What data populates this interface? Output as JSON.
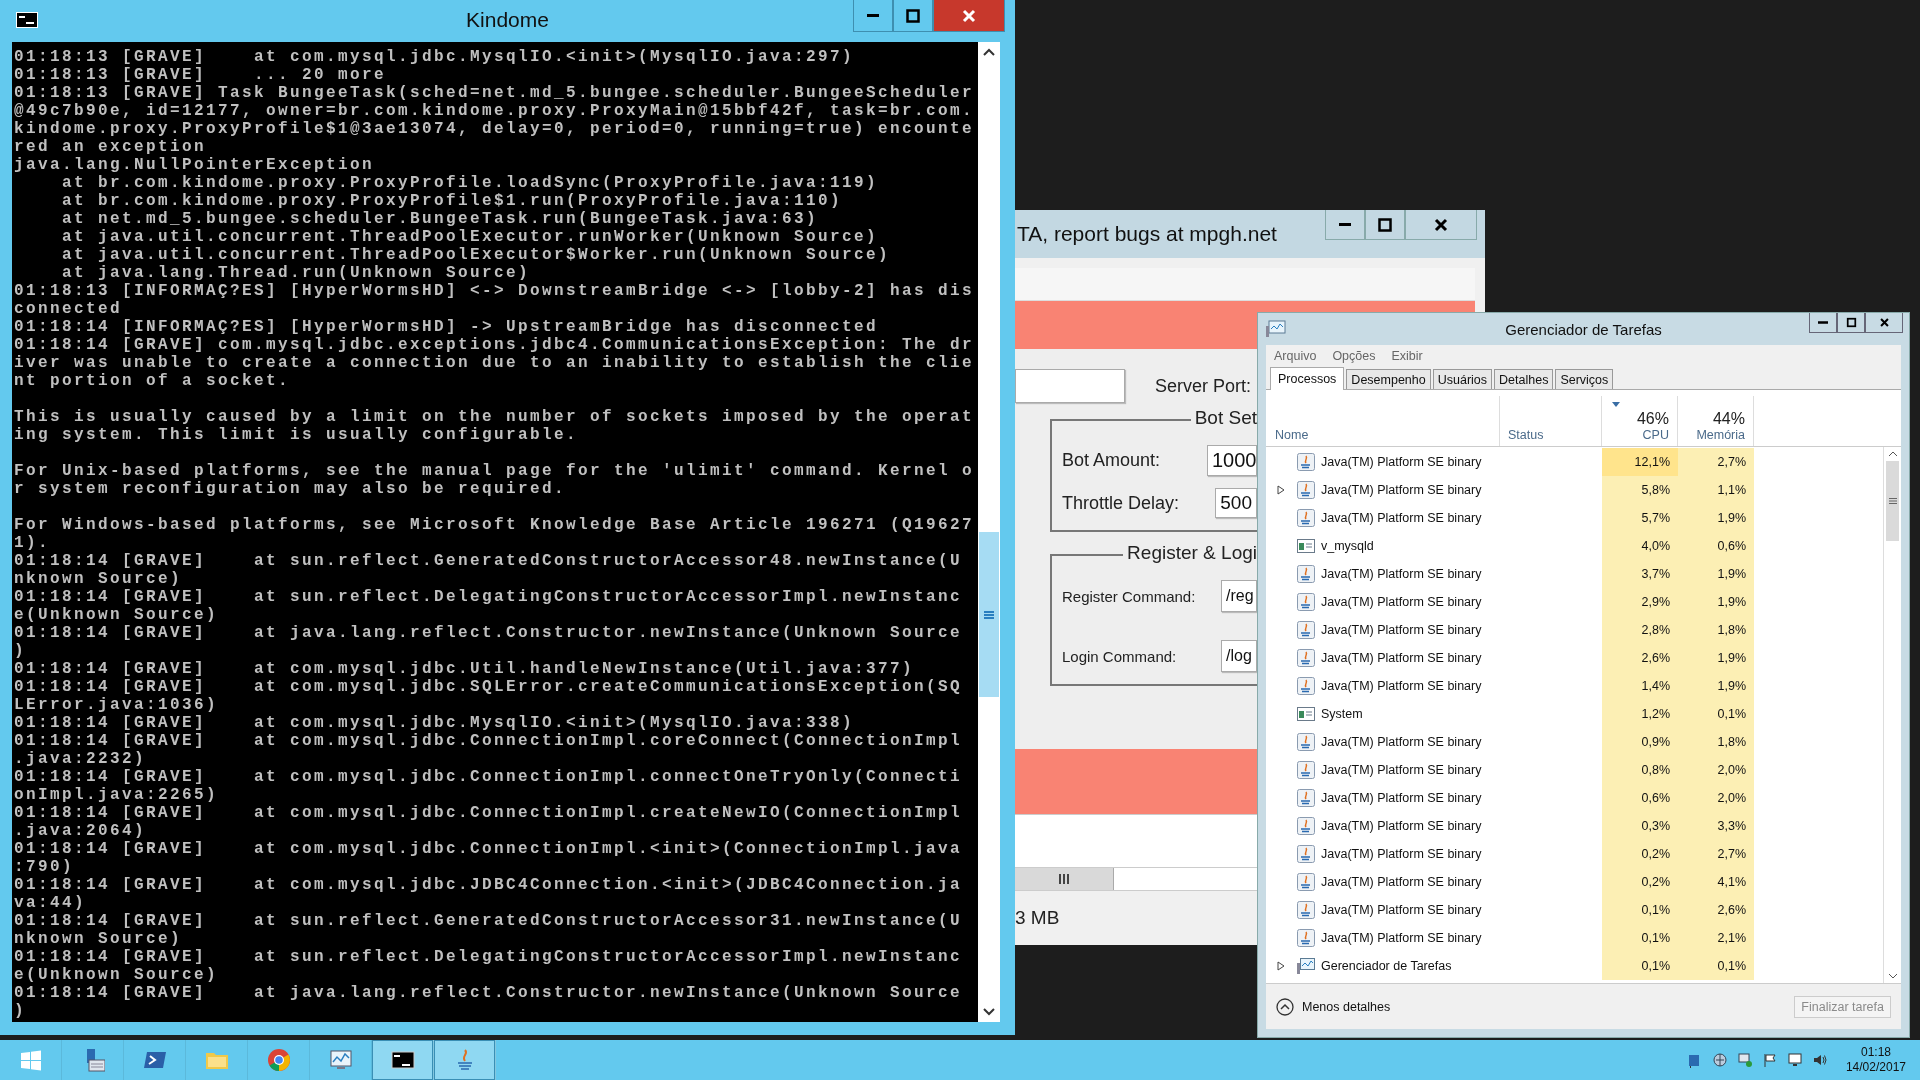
{
  "console_window": {
    "title": "Kindome",
    "blocks": [
      [
        "01:18:13 [GRAVE]    at com.mysql.jdbc.MysqlIO.<init>(MysqlIO.java:297)",
        "01:18:13 [GRAVE]    ... 20 more",
        "01:18:13 [GRAVE] Task BungeeTask(sched=net.md_5.bungee.scheduler.BungeeScheduler",
        "@49c7b90e, id=12177, owner=br.com.kindome.proxy.ProxyMain@15bbf42f, task=br.com.",
        "kindome.proxy.ProxyProfile$1@3ae13074, delay=0, period=0, running=true) encounte",
        "red an exception",
        "java.lang.NullPointerException",
        "    at br.com.kindome.proxy.ProxyProfile.loadSync(ProxyProfile.java:119)",
        "    at br.com.kindome.proxy.ProxyProfile$1.run(ProxyProfile.java:110)",
        "    at net.md_5.bungee.scheduler.BungeeTask.run(BungeeTask.java:63)",
        "    at java.util.concurrent.ThreadPoolExecutor.runWorker(Unknown Source)",
        "    at java.util.concurrent.ThreadPoolExecutor$Worker.run(Unknown Source)",
        "    at java.lang.Thread.run(Unknown Source)",
        "01:18:13 [INFORMAÇ?ES] [HyperWormsHD] <-> DownstreamBridge <-> [lobby-2] has dis",
        "connected",
        "01:18:14 [INFORMAÇ?ES] [HyperWormsHD] -> UpstreamBridge has disconnected",
        "01:18:14 [GRAVE] com.mysql.jdbc.exceptions.jdbc4.CommunicationsException: The dr",
        "iver was unable to create a connection due to an inability to establish the clie",
        "nt portion of a socket."
      ],
      [
        "This is usually caused by a limit on the number of sockets imposed by the operat",
        "ing system. This limit is usually configurable."
      ],
      [
        "For Unix-based platforms, see the manual page for the 'ulimit' command. Kernel o",
        "r system reconfiguration may also be required."
      ],
      [
        "For Windows-based platforms, see Microsoft Knowledge Base Article 196271 (Q19627",
        "1).",
        "01:18:14 [GRAVE]    at sun.reflect.GeneratedConstructorAccessor48.newInstance(U",
        "nknown Source)",
        "01:18:14 [GRAVE]    at sun.reflect.DelegatingConstructorAccessorImpl.newInstanc",
        "e(Unknown Source)",
        "01:18:14 [GRAVE]    at java.lang.reflect.Constructor.newInstance(Unknown Source",
        ")",
        "01:18:14 [GRAVE]    at com.mysql.jdbc.Util.handleNewInstance(Util.java:377)",
        "01:18:14 [GRAVE]    at com.mysql.jdbc.SQLError.createCommunicationsException(SQ",
        "LError.java:1036)",
        "01:18:14 [GRAVE]    at com.mysql.jdbc.MysqlIO.<init>(MysqlIO.java:338)",
        "01:18:14 [GRAVE]    at com.mysql.jdbc.ConnectionImpl.coreConnect(ConnectionImpl",
        ".java:2232)",
        "01:18:14 [GRAVE]    at com.mysql.jdbc.ConnectionImpl.connectOneTryOnly(Connecti",
        "onImpl.java:2265)",
        "01:18:14 [GRAVE]    at com.mysql.jdbc.ConnectionImpl.createNewIO(ConnectionImpl",
        ".java:2064)",
        "01:18:14 [GRAVE]    at com.mysql.jdbc.ConnectionImpl.<init>(ConnectionImpl.java",
        ":790)",
        "01:18:14 [GRAVE]    at com.mysql.jdbc.JDBC4Connection.<init>(JDBC4Connection.ja",
        "va:44)",
        "01:18:14 [GRAVE]    at sun.reflect.GeneratedConstructorAccessor31.newInstance(U",
        "nknown Source)",
        "01:18:14 [GRAVE]    at sun.reflect.DelegatingConstructorAccessorImpl.newInstanc",
        "e(Unknown Source)",
        "01:18:14 [GRAVE]    at java.lang.reflect.Constructor.newInstance(Unknown Source",
        ")"
      ]
    ]
  },
  "bot_window": {
    "title": "TA, report bugs at mpgh.net",
    "server_port_label": "Server Port:",
    "groups": [
      {
        "legend": "Bot Set",
        "fields": [
          {
            "label": "Bot Amount:",
            "value": "1000"
          },
          {
            "label": "Throttle Delay:",
            "value": "500"
          }
        ]
      },
      {
        "legend": "Register & Logi",
        "fields": [
          {
            "label": "Register Command:",
            "value": "/reg"
          },
          {
            "label": "Login Command:",
            "value": "/log"
          }
        ]
      }
    ],
    "memory": "3 MB"
  },
  "task_manager": {
    "title": "Gerenciador de Tarefas",
    "menu": [
      "Arquivo",
      "Opções",
      "Exibir"
    ],
    "tabs": [
      {
        "label": "Processos",
        "selected": true
      },
      {
        "label": "Desempenho",
        "selected": false
      },
      {
        "label": "Usuários",
        "selected": false
      },
      {
        "label": "Detalhes",
        "selected": false
      },
      {
        "label": "Serviços",
        "selected": false
      }
    ],
    "columns": {
      "name": "Nome",
      "status": "Status",
      "cpu_total": "46%",
      "cpu": "CPU",
      "memory_total": "44%",
      "memory": "Memória"
    },
    "rows": [
      {
        "name": "Java(TM) Platform SE binary",
        "kind": "java",
        "expandable": false,
        "cpu": "12,1%",
        "memory": "2,7%",
        "color": "#ffe48c"
      },
      {
        "name": "Java(TM) Platform SE binary",
        "kind": "java",
        "expandable": true,
        "cpu": "5,8%",
        "memory": "1,1%",
        "color": "#fcefb4"
      },
      {
        "name": "Java(TM) Platform SE binary",
        "kind": "java",
        "expandable": false,
        "cpu": "5,7%",
        "memory": "1,9%",
        "color": "#fcefb4"
      },
      {
        "name": "v_mysqld",
        "kind": "service",
        "expandable": false,
        "cpu": "4,0%",
        "memory": "0,6%",
        "color": "#fcefb4"
      },
      {
        "name": "Java(TM) Platform SE binary",
        "kind": "java",
        "expandable": false,
        "cpu": "3,7%",
        "memory": "1,9%",
        "color": "#fcefb4"
      },
      {
        "name": "Java(TM) Platform SE binary",
        "kind": "java",
        "expandable": false,
        "cpu": "2,9%",
        "memory": "1,9%",
        "color": "#fcefb4"
      },
      {
        "name": "Java(TM) Platform SE binary",
        "kind": "java",
        "expandable": false,
        "cpu": "2,8%",
        "memory": "1,8%",
        "color": "#fcefb4"
      },
      {
        "name": "Java(TM) Platform SE binary",
        "kind": "java",
        "expandable": false,
        "cpu": "2,6%",
        "memory": "1,9%",
        "color": "#fcefb4"
      },
      {
        "name": "Java(TM) Platform SE binary",
        "kind": "java",
        "expandable": false,
        "cpu": "1,4%",
        "memory": "1,9%",
        "color": "#fcefb4"
      },
      {
        "name": "System",
        "kind": "service",
        "expandable": false,
        "cpu": "1,2%",
        "memory": "0,1%",
        "color": "#fcefb4"
      },
      {
        "name": "Java(TM) Platform SE binary",
        "kind": "java",
        "expandable": false,
        "cpu": "0,9%",
        "memory": "1,8%",
        "color": "#fcefb4"
      },
      {
        "name": "Java(TM) Platform SE binary",
        "kind": "java",
        "expandable": false,
        "cpu": "0,8%",
        "memory": "2,0%",
        "color": "#fcefb4"
      },
      {
        "name": "Java(TM) Platform SE binary",
        "kind": "java",
        "expandable": false,
        "cpu": "0,6%",
        "memory": "2,0%",
        "color": "#fcefb4"
      },
      {
        "name": "Java(TM) Platform SE binary",
        "kind": "java",
        "expandable": false,
        "cpu": "0,3%",
        "memory": "3,3%",
        "color": "#fcefb4"
      },
      {
        "name": "Java(TM) Platform SE binary",
        "kind": "java",
        "expandable": false,
        "cpu": "0,2%",
        "memory": "2,7%",
        "color": "#fcefb4"
      },
      {
        "name": "Java(TM) Platform SE binary",
        "kind": "java",
        "expandable": false,
        "cpu": "0,2%",
        "memory": "4,1%",
        "color": "#fcefb4"
      },
      {
        "name": "Java(TM) Platform SE binary",
        "kind": "java",
        "expandable": false,
        "cpu": "0,1%",
        "memory": "2,6%",
        "color": "#fcefb4"
      },
      {
        "name": "Java(TM) Platform SE binary",
        "kind": "java",
        "expandable": false,
        "cpu": "0,1%",
        "memory": "2,1%",
        "color": "#fcefb4"
      },
      {
        "name": "Gerenciador de Tarefas",
        "kind": "taskmgr",
        "expandable": true,
        "cpu": "0,1%",
        "memory": "0,1%",
        "color": "#fcefb4"
      }
    ],
    "less_details": "Menos detalhes",
    "end_task": {
      "label": "Finalizar tarefa",
      "disabled": true
    }
  },
  "taskbar": {
    "apps": [
      {
        "kind": "start",
        "active": false
      },
      {
        "kind": "server",
        "active": false
      },
      {
        "kind": "powershell",
        "active": false
      },
      {
        "kind": "folder",
        "active": false
      },
      {
        "kind": "chrome",
        "active": false
      },
      {
        "kind": "monitor",
        "active": false
      },
      {
        "kind": "console",
        "active": true
      },
      {
        "kind": "java",
        "active": true
      }
    ],
    "clock": {
      "time": "01:18",
      "date": "14/02/2017"
    }
  }
}
